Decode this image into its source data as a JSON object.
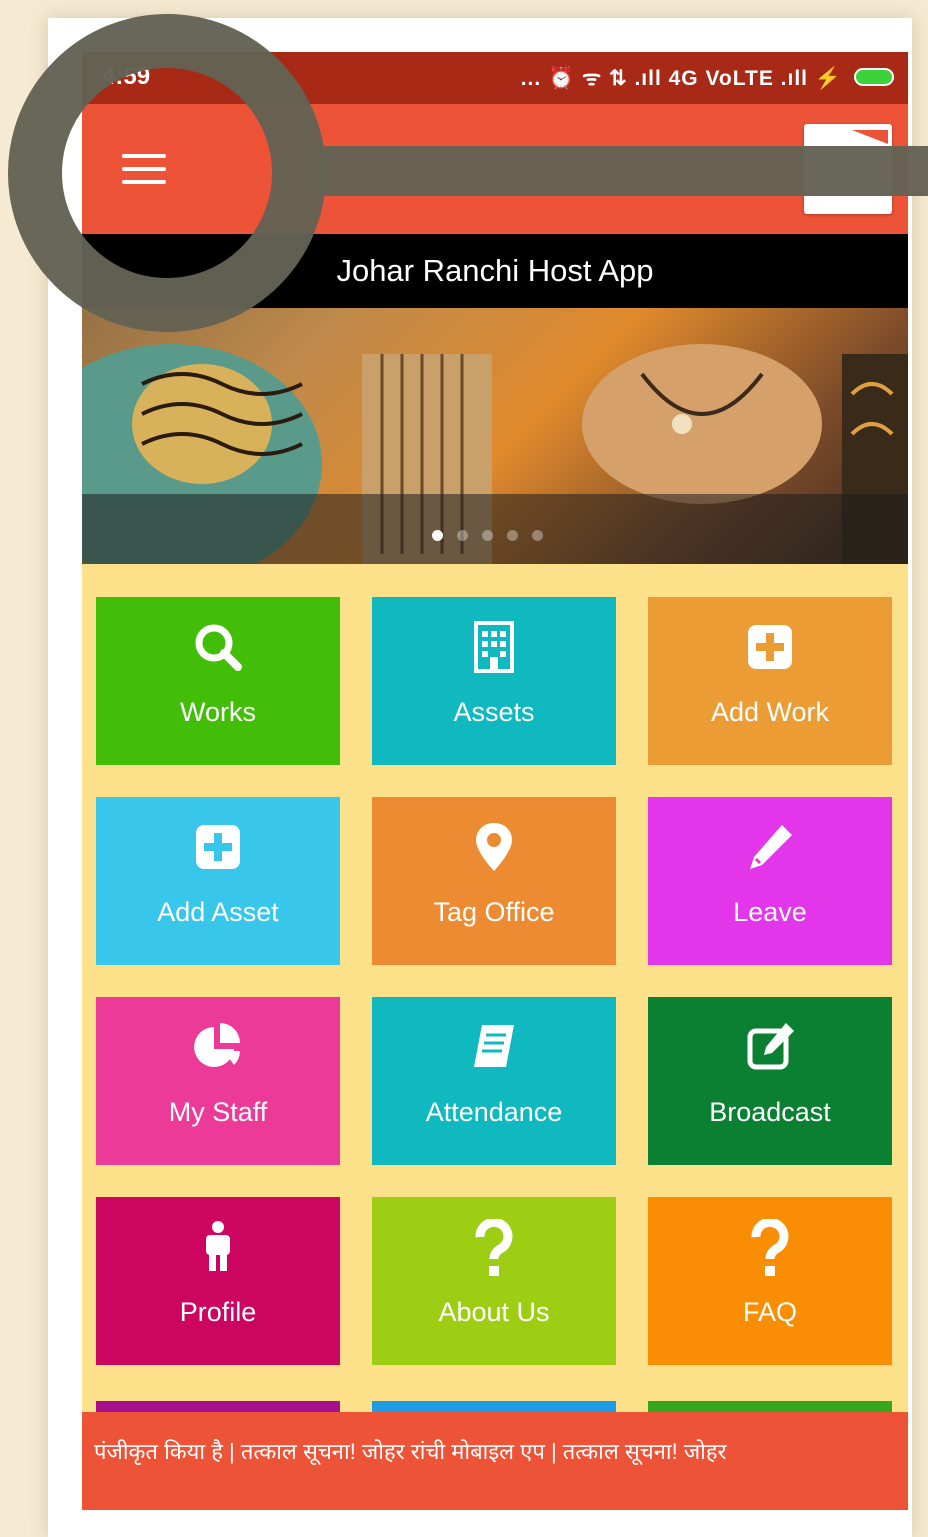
{
  "status_bar": {
    "time": "4:59",
    "indicators": "... ⏰ ᯤ ⇅ .ıll 4G VoLTE .ıll ⚡"
  },
  "app_bar": {
    "menu_icon": "hamburger-menu-icon"
  },
  "banner": {
    "title": "Johar Ranchi Host App",
    "slide_count": 5,
    "active_slide": 1
  },
  "tiles": [
    {
      "label": "Works",
      "icon": "search-icon",
      "color": "#43be08"
    },
    {
      "label": "Assets",
      "icon": "building-icon",
      "color": "#10b8c0"
    },
    {
      "label": "Add Work",
      "icon": "plus-square-icon",
      "color": "#eb9c35"
    },
    {
      "label": "Add Asset",
      "icon": "plus-square-icon",
      "color": "#38c6ea"
    },
    {
      "label": "Tag Office",
      "icon": "map-marker-icon",
      "color": "#ec8b32"
    },
    {
      "label": "Leave",
      "icon": "pencil-icon",
      "color": "#e335ea"
    },
    {
      "label": "My Staff",
      "icon": "pie-chart-icon",
      "color": "#ec3a98"
    },
    {
      "label": "Attendance",
      "icon": "book-icon",
      "color": "#10b8c0"
    },
    {
      "label": "Broadcast",
      "icon": "edit-square-icon",
      "color": "#0b8032"
    },
    {
      "label": "Profile",
      "icon": "person-icon",
      "color": "#cc0561"
    },
    {
      "label": "About Us",
      "icon": "question-icon",
      "color": "#9dce14"
    },
    {
      "label": "FAQ",
      "icon": "question-icon",
      "color": "#f98d03"
    }
  ],
  "ticker": {
    "text": "पंजीकृत किया है | तत्काल सूचना! जोहर रांची मोबाइल एप | तत्काल सूचना! जोहर"
  }
}
